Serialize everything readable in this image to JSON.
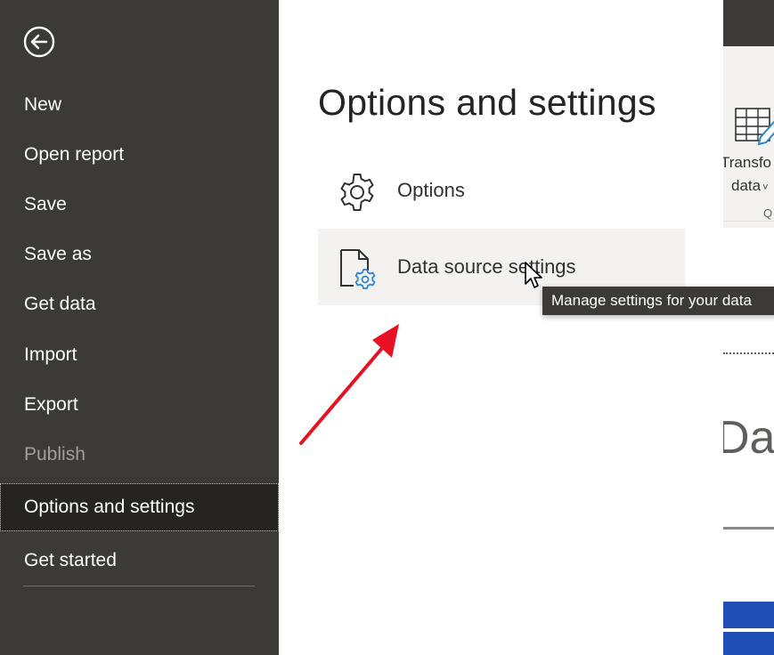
{
  "sidebar": {
    "back_icon": "back-arrow-icon",
    "items": [
      {
        "label": "New",
        "state": "normal"
      },
      {
        "label": "Open report",
        "state": "normal"
      },
      {
        "label": "Save",
        "state": "normal"
      },
      {
        "label": "Save as",
        "state": "normal"
      },
      {
        "label": "Get data",
        "state": "normal"
      },
      {
        "label": "Import",
        "state": "normal"
      },
      {
        "label": "Export",
        "state": "normal"
      },
      {
        "label": "Publish",
        "state": "disabled"
      },
      {
        "label": "Options and settings",
        "state": "selected"
      },
      {
        "label": "Get started",
        "state": "normal"
      }
    ]
  },
  "panel": {
    "title": "Options and settings",
    "options": [
      {
        "label": "Options",
        "icon": "gear-icon"
      },
      {
        "label": "Data source settings",
        "icon": "data-source-settings-icon"
      }
    ]
  },
  "tooltip": {
    "text": "Manage settings for your data"
  },
  "ribbon": {
    "button_line1": "Transfo",
    "button_line2": "data",
    "group_letter": "Q"
  },
  "canvas": {
    "partial_text": "Das"
  },
  "colors": {
    "sidebar_bg": "#3b3a39",
    "selected_bg": "#252423",
    "hover_bg": "#f3f2f1",
    "accent_blue": "#2b88d8",
    "arrow_red": "#e81123"
  }
}
